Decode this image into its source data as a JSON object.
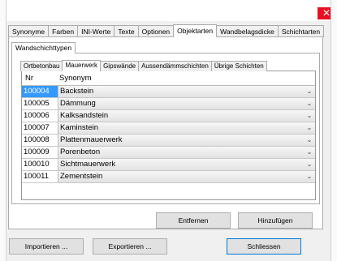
{
  "window": {
    "close_label": "✕"
  },
  "top_tabs": [
    {
      "label": "Synonyme",
      "active": false
    },
    {
      "label": "Farben",
      "active": false
    },
    {
      "label": "INI-Werte",
      "active": false
    },
    {
      "label": "Texte",
      "active": false
    },
    {
      "label": "Optionen",
      "active": false
    },
    {
      "label": "Objektarten",
      "active": true
    },
    {
      "label": "Wandbelagsdicke",
      "active": false
    },
    {
      "label": "Schichtarten",
      "active": false
    }
  ],
  "sub_tab": {
    "label": "Wandschichttypen"
  },
  "inner_tabs": [
    {
      "label": "Ortbetonbau",
      "active": false
    },
    {
      "label": "Mauerwerk",
      "active": true
    },
    {
      "label": "Gipswände",
      "active": false
    },
    {
      "label": "Aussendämmschichten",
      "active": false
    },
    {
      "label": "Übrige Schichten",
      "active": false
    }
  ],
  "grid": {
    "col_nr": "Nr",
    "col_synonym": "Synonym",
    "rows": [
      {
        "nr": "100004",
        "synonym": "Backstein"
      },
      {
        "nr": "100005",
        "synonym": "Dämmung"
      },
      {
        "nr": "100006",
        "synonym": "Kalksandstein"
      },
      {
        "nr": "100007",
        "synonym": "Kaminstein"
      },
      {
        "nr": "100008",
        "synonym": "Plattenmauerwerk"
      },
      {
        "nr": "100009",
        "synonym": "Porenbeton"
      },
      {
        "nr": "100010",
        "synonym": "Sichtmauerwerk"
      },
      {
        "nr": "100011",
        "synonym": "Zementstein"
      }
    ],
    "selected_index": 0,
    "dropdown_icon": "chevron-down-icon"
  },
  "buttons": {
    "entfernen": "Entfernen",
    "hinzufuegen": "Hinzufügen",
    "importieren": "Importieren ...",
    "exportieren": "Exportieren ...",
    "schliessen": "Schliessen"
  },
  "colors": {
    "selection": "#3399ff",
    "close": "#e81123"
  }
}
